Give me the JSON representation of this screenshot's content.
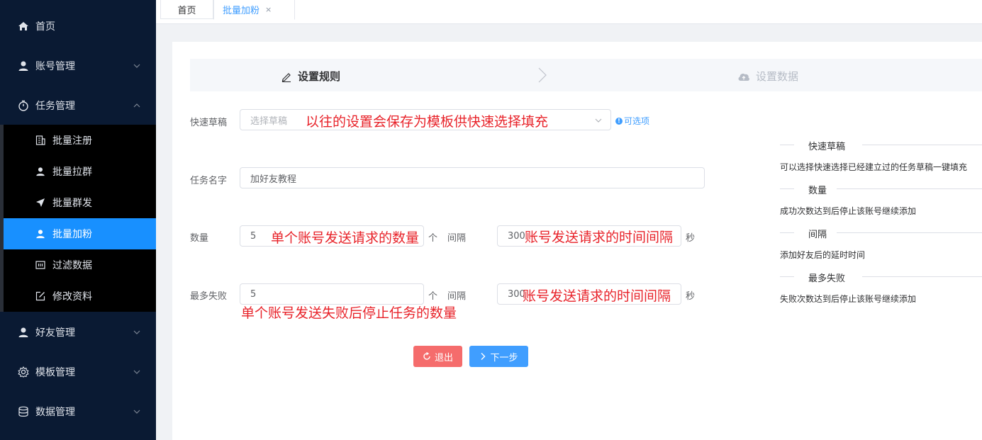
{
  "sidebar": {
    "home": "首页",
    "account": "账号管理",
    "task": "任务管理",
    "sub": [
      {
        "label": "批量注册"
      },
      {
        "label": "批量拉群"
      },
      {
        "label": "批量群发"
      },
      {
        "label": "批量加粉"
      },
      {
        "label": "过滤数据"
      },
      {
        "label": "修改资料"
      }
    ],
    "friends": "好友管理",
    "template": "模板管理",
    "data": "数据管理",
    "active_color": "#1890ff"
  },
  "tabs": [
    {
      "label": "首页"
    },
    {
      "label": "批量加粉",
      "close": "×"
    }
  ],
  "steps": {
    "step1": "设置规则",
    "step2": "设置数据"
  },
  "form": {
    "draft_label": "快速草稿",
    "draft_placeholder": "选择草稿",
    "draft_hint": "可选项",
    "draft_hint_icon": "!",
    "task_label": "任务名字",
    "task_value": "加好友教程",
    "qty_label": "数量",
    "qty_value": "5",
    "qty_unit": "个",
    "interval_label": "间隔",
    "interval_value": "300",
    "interval_unit": "秒",
    "maxfail_label": "最多失败",
    "maxfail_value": "5",
    "maxfail_unit": "个",
    "interval2_label": "间隔",
    "interval2_value": "300",
    "interval2_unit": "秒"
  },
  "annotations": {
    "a1": "以往的设置会保存为模板供快速选择填充",
    "a2": "单个账号发送请求的数量",
    "a3": "账号发送请求的时间间隔",
    "a4": "账号发送请求的时间间隔",
    "a5": "单个账号发送失败后停止任务的数量"
  },
  "buttons": {
    "exit": "退出",
    "next": "下一步"
  },
  "help": {
    "h1": "快速草稿",
    "p1": "可以选择快速选择已经建立过的任务草稿一键填充",
    "h2": "数量",
    "p2": "成功次数达到后停止该账号继续添加",
    "h3": "间隔",
    "p3": "添加好友后的延时时间",
    "h4": "最多失败",
    "p4": "失败次数达到后停止该账号继续添加"
  }
}
